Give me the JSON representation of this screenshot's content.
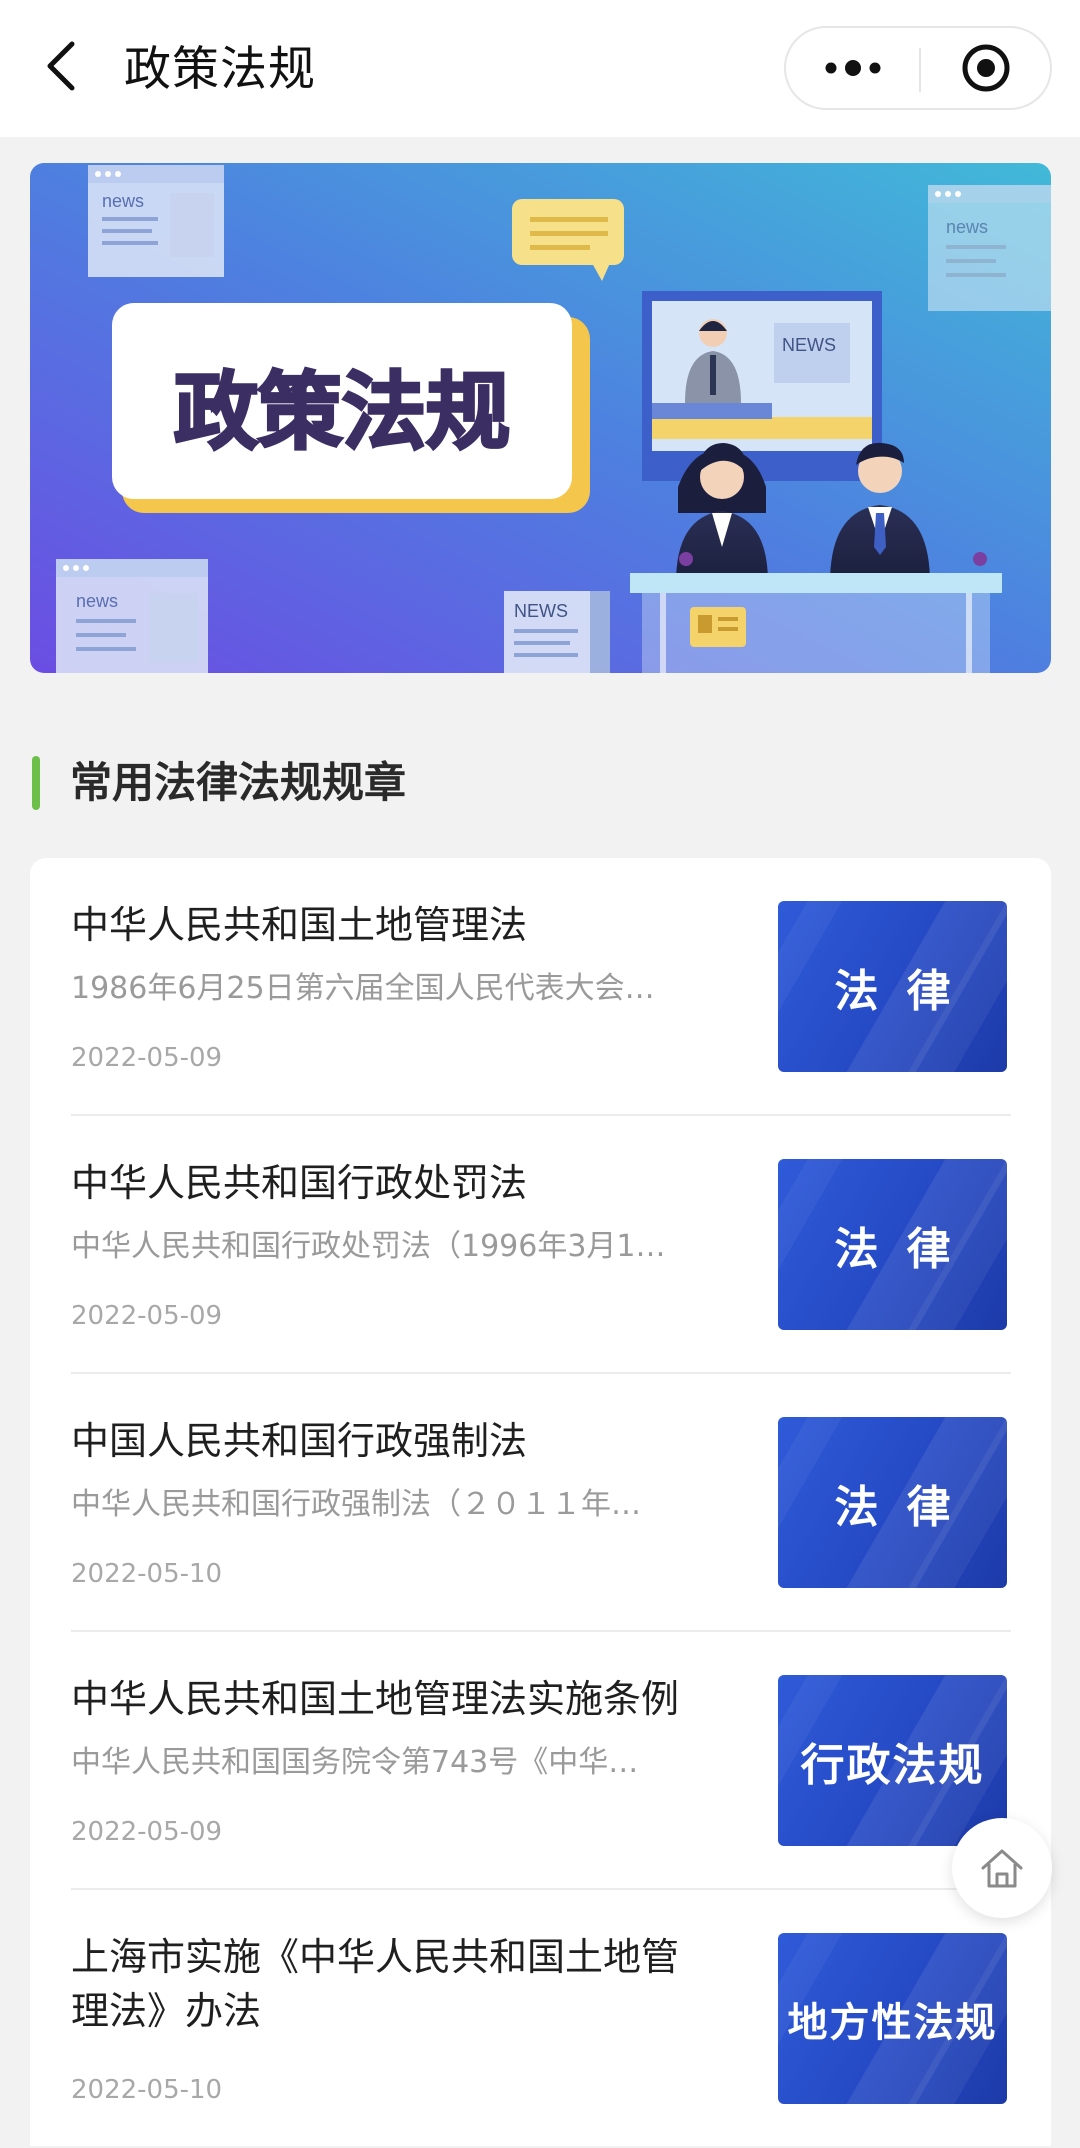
{
  "navbar": {
    "title": "政策法规",
    "back_icon": "chevron-left-icon",
    "more_icon": "more-dots-icon",
    "close_icon": "target-circle-icon"
  },
  "banner": {
    "headline": "政策法规",
    "news_label": "news",
    "news_label_caps": "NEWS",
    "colors": {
      "gradient_start": "#6a4fe0",
      "gradient_end": "#3fb6d9",
      "headline_box": "#ffffff",
      "headline_shadow": "#f5c84a"
    }
  },
  "section": {
    "title": "常用法律法规规章",
    "accent_color": "#6cc04a"
  },
  "items": [
    {
      "title": "中华人民共和国土地管理法",
      "summary": "1986年6月25日第六届全国人民代表大会…",
      "date": "2022-05-09",
      "tag": "法律"
    },
    {
      "title": "中华人民共和国行政处罚法",
      "summary": "中华人民共和国行政处罚法（1996年3月1…",
      "date": "2022-05-09",
      "tag": "法律"
    },
    {
      "title": "中国人民共和国行政强制法",
      "summary": "中华人民共和国行政强制法（２０１１年…",
      "date": "2022-05-10",
      "tag": "法律"
    },
    {
      "title": "中华人民共和国土地管理法实施条例",
      "summary": "中华人民共和国国务院令第743号《中华…",
      "date": "2022-05-09",
      "tag": "行政法规"
    },
    {
      "title": "上海市实施《中华人民共和国土地管理法》办法",
      "summary": "",
      "date": "2022-05-10",
      "tag": "地方性法规"
    }
  ],
  "fab": {
    "icon": "home-icon"
  }
}
